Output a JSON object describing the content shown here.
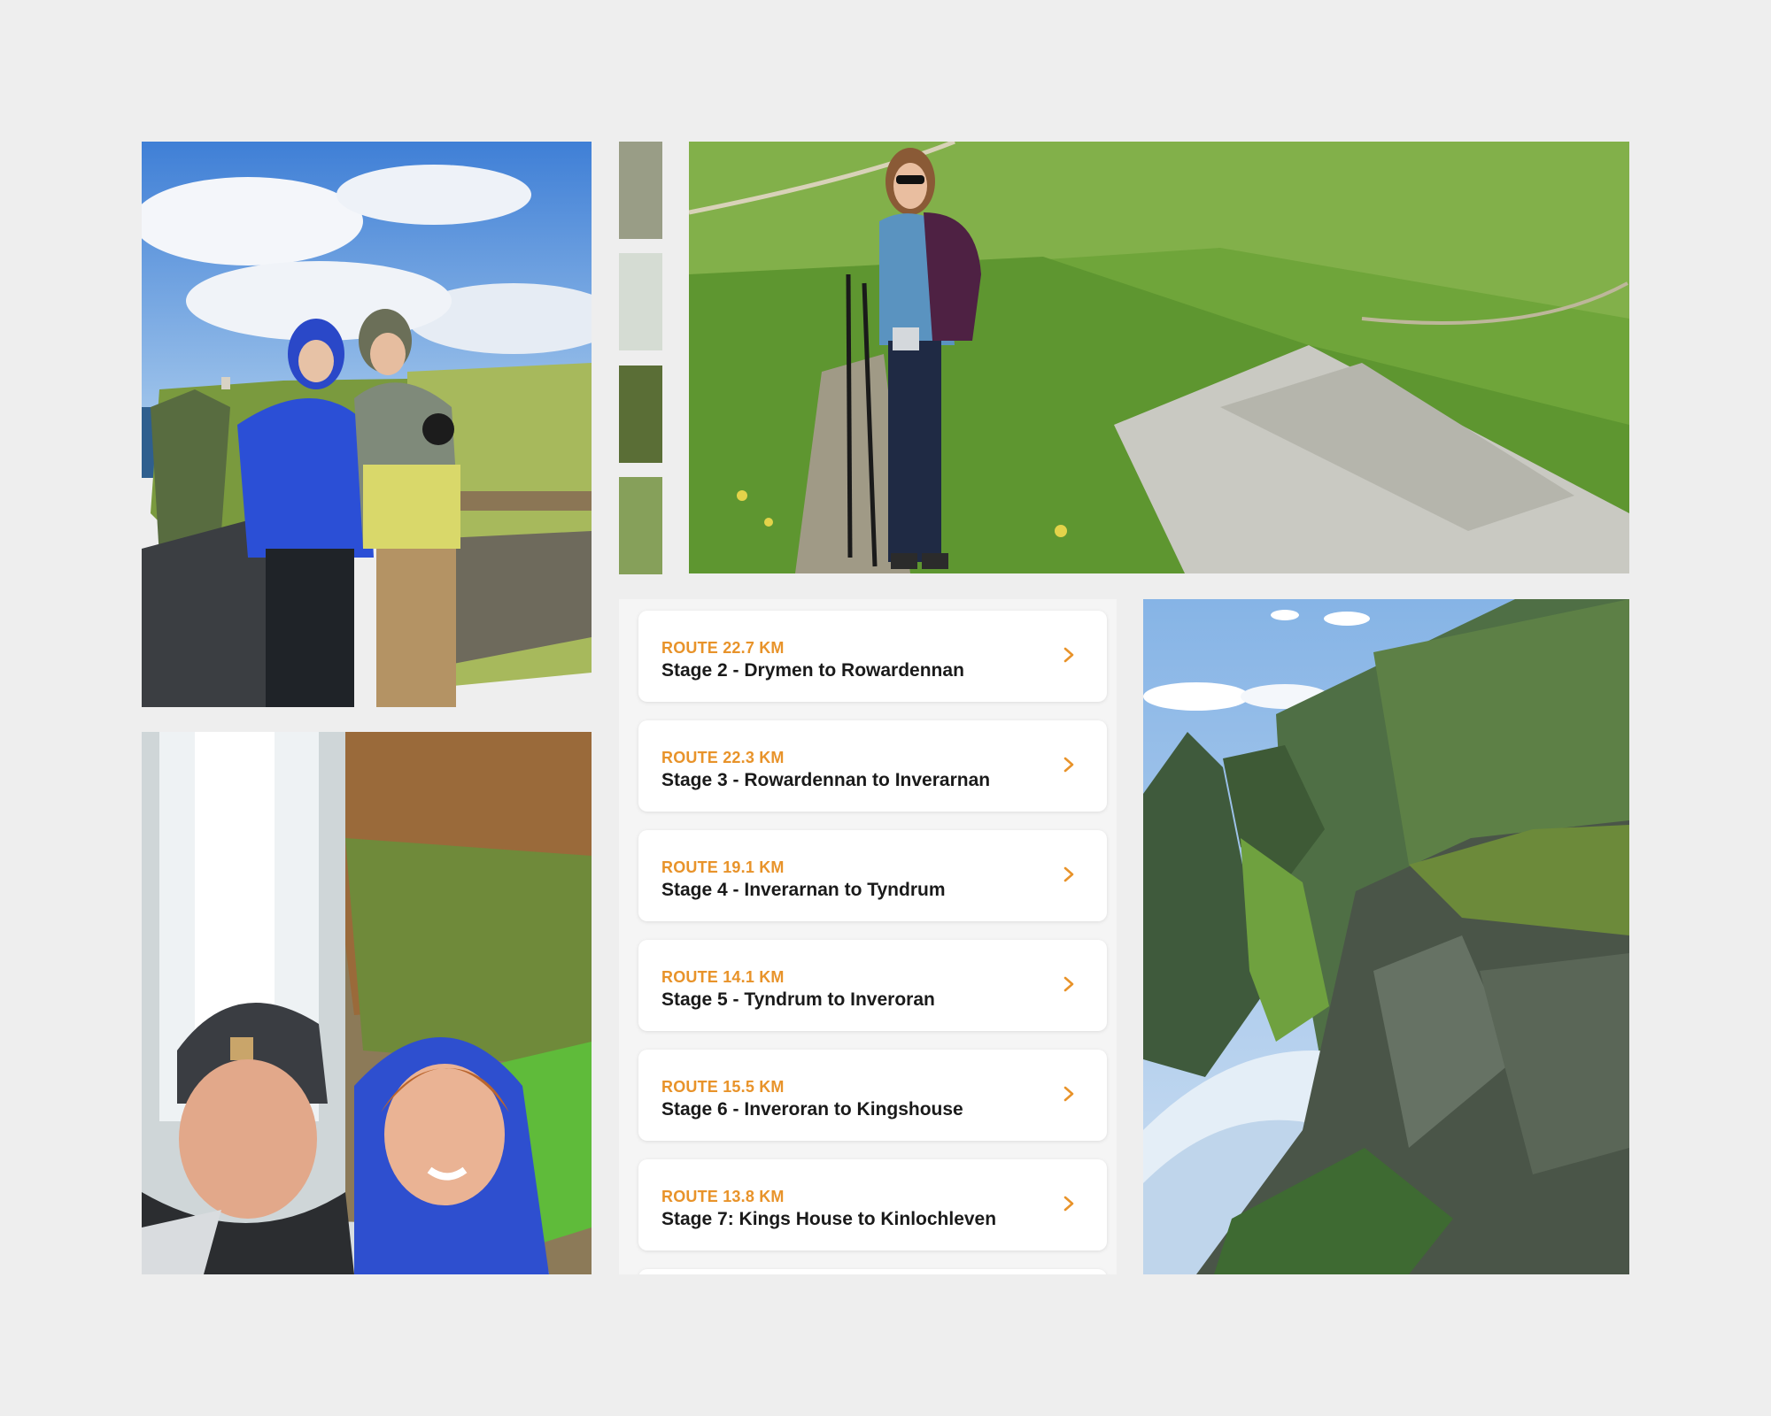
{
  "palette": {
    "swatch_1": "#999d86",
    "swatch_2": "#d5dcd3",
    "swatch_3": "#5a6e36",
    "swatch_4": "#86a05a"
  },
  "accent_color": "#e8932a",
  "photos": {
    "cliffs": "couple-on-cliffs-photo",
    "falls": "waterfall-selfie-photo",
    "hiker": "hiker-on-trail-photo",
    "mountain": "mountain-cliffs-photo"
  },
  "routes": [
    {
      "distance": "ROUTE 22.7 KM",
      "title": "Stage 2 - Drymen to Rowardennan",
      "icon": "chevron-right-icon"
    },
    {
      "distance": "ROUTE 22.3 KM",
      "title": "Stage 3 - Rowardennan to Inverarnan",
      "icon": "chevron-right-icon"
    },
    {
      "distance": "ROUTE 19.1 KM",
      "title": "Stage 4 - Inverarnan to Tyndrum",
      "icon": "chevron-right-icon"
    },
    {
      "distance": "ROUTE 14.1 KM",
      "title": "Stage 5 - Tyndrum to Inveroran",
      "icon": "chevron-right-icon"
    },
    {
      "distance": "ROUTE 15.5 KM",
      "title": "Stage 6 - Inveroran to Kingshouse",
      "icon": "chevron-right-icon"
    },
    {
      "distance": "ROUTE 13.8 KM",
      "title": "Stage 7: Kings House to Kinlochleven",
      "icon": "chevron-right-icon"
    }
  ]
}
